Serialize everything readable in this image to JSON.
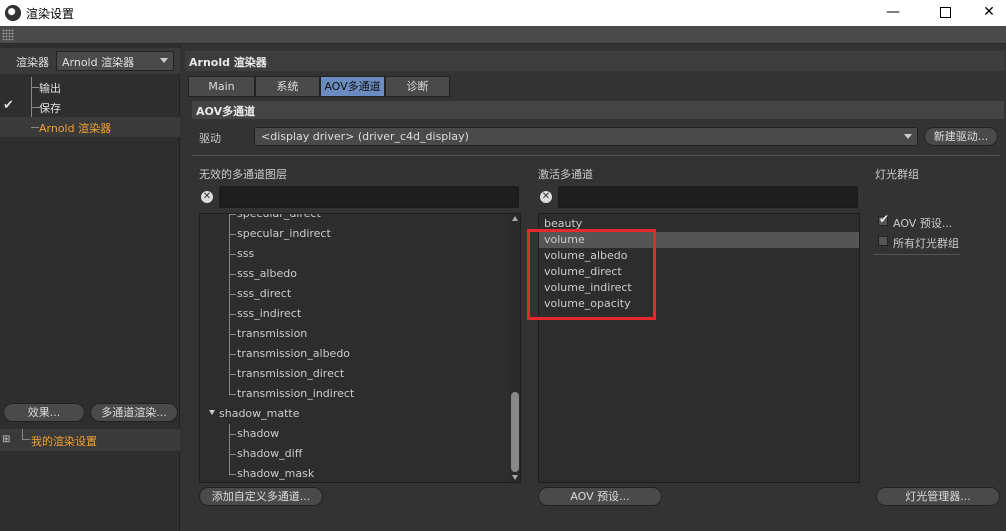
{
  "window": {
    "title": "渲染设置",
    "minimize": "—",
    "close": "✕"
  },
  "left": {
    "renderer_label": "渲染器",
    "renderer_value": "Arnold 渲染器",
    "tree": [
      {
        "label": "输出",
        "checked": false
      },
      {
        "label": "保存",
        "checked": true
      },
      {
        "label": "Arnold 渲染器",
        "checked": false,
        "accent": true
      }
    ],
    "check_mark": "✔",
    "effects_button": "效果...",
    "multipass_button": "多通道渲染...",
    "my_settings": "我的渲染设置",
    "expand_icon": "⊞"
  },
  "right": {
    "panel_title": "Arnold 渲染器",
    "tabs": [
      {
        "label": "Main",
        "active": false
      },
      {
        "label": "系统",
        "active": false
      },
      {
        "label": "AOV多通道",
        "active": true
      },
      {
        "label": "诊断",
        "active": false
      }
    ],
    "section_title": "AOV多通道",
    "driver_label": "驱动",
    "driver_value": "<display driver> (driver_c4d_display)",
    "new_driver_button": "新建驱动...",
    "inactive_title": "无效的多通道图层",
    "active_title": "激活多通道",
    "light_title": "灯光群组",
    "clear_glyph": "✕",
    "inactive_items": [
      {
        "label": "specular_direct",
        "type": "child"
      },
      {
        "label": "specular_indirect",
        "type": "child"
      },
      {
        "label": "sss",
        "type": "child"
      },
      {
        "label": "sss_albedo",
        "type": "child"
      },
      {
        "label": "sss_direct",
        "type": "child"
      },
      {
        "label": "sss_indirect",
        "type": "child"
      },
      {
        "label": "transmission",
        "type": "child"
      },
      {
        "label": "transmission_albedo",
        "type": "child"
      },
      {
        "label": "transmission_direct",
        "type": "child"
      },
      {
        "label": "transmission_indirect",
        "type": "child"
      },
      {
        "label": "shadow_matte",
        "type": "parent"
      },
      {
        "label": "shadow",
        "type": "child"
      },
      {
        "label": "shadow_diff",
        "type": "child"
      },
      {
        "label": "shadow_mask",
        "type": "child"
      }
    ],
    "active_items": [
      {
        "label": "beauty",
        "selected": false
      },
      {
        "label": "volume",
        "selected": true
      },
      {
        "label": "volume_albedo",
        "selected": false
      },
      {
        "label": "volume_direct",
        "selected": false
      },
      {
        "label": "volume_indirect",
        "selected": false
      },
      {
        "label": "volume_opacity",
        "selected": false
      }
    ],
    "light_groups": [
      {
        "label": "AOV 预设...",
        "checked": true
      },
      {
        "label": "所有灯光群组",
        "checked": false
      }
    ],
    "add_custom_button": "添加自定义多通道...",
    "aov_preset_button": "AOV 预设...",
    "light_manager_button": "灯光管理器...",
    "highlight_color": "#e8282a"
  }
}
